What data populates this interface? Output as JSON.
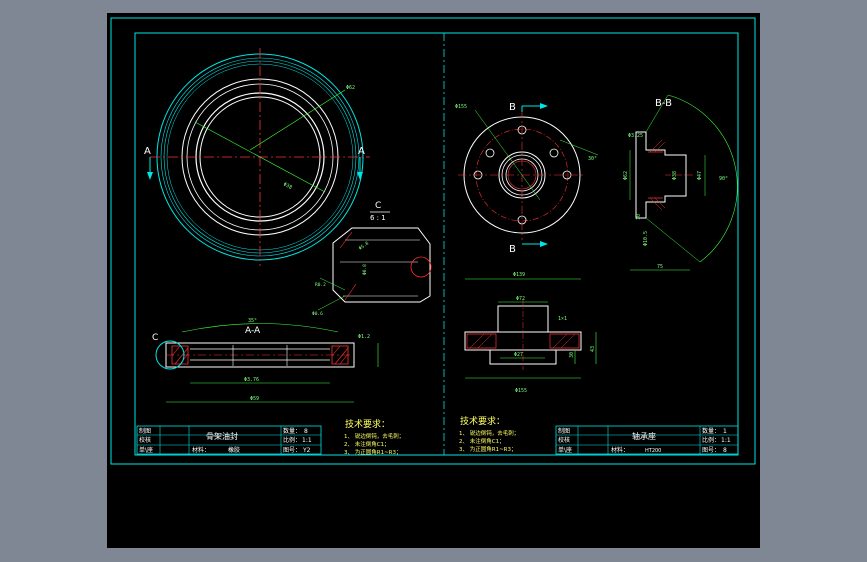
{
  "colors": {
    "background": "#7f8794",
    "canvas": "#000000",
    "frame": "#00e6e6",
    "outline": "#ffffff",
    "dimension": "#3cff3c",
    "centerline": "#ff3030",
    "hatch": "#ff3030",
    "note_text": "#ffff66"
  },
  "left_part": {
    "section_label": "A-A",
    "cut_label_a": "A",
    "detail_label": "C",
    "detail_scale": "6 : 1",
    "detail_ref": "C",
    "dims": {
      "outer": "Φ62",
      "inner": "Φ38",
      "angle": "35°",
      "bottom_inner": "Φ3.76",
      "bottom_outer": "Φ59",
      "right": "Φ1.2",
      "detail_a": "Φ5.8",
      "detail_b": "Φ0.8",
      "detail_c": "R0.2",
      "detail_d": "Φ0.6"
    },
    "notes_title": "技术要求：",
    "notes": [
      "1、 锐边倒钝，去毛刺；",
      "2、 未注倒角C1；",
      "3、 为正圆角R1~R3；"
    ],
    "title_block": {
      "design": "制图",
      "check": "校核",
      "name": "骨架油封",
      "qty_label": "数量：",
      "qty": "8",
      "scale_label": "比例：",
      "scale": "1:1",
      "unit": "单\\座",
      "material_label": "材料：",
      "material": "橡胶",
      "number_label": "图号：",
      "number": "Y2"
    }
  },
  "right_part": {
    "cut_label_b": "B",
    "section_label": "B-B",
    "dims": {
      "bolt_circle": "Φ155",
      "top_width": "Φ139",
      "boss": "Φ72",
      "bore": "Φ27",
      "bottom_width": "Φ155",
      "height_a": "43",
      "height_b": "30",
      "chamfer": "1×1",
      "sec_top": "Φ3.25",
      "sec_left": "Φ62",
      "sec_mid": "Φ38",
      "sec_right": "Φ47",
      "sec_small": "10",
      "sec_low": "Φ10.5",
      "sec_width": "75",
      "angle_right": "90°",
      "angle_top": "30°"
    },
    "notes_title": "技术要求：",
    "notes": [
      "1、 锐边倒钝，去毛刺；",
      "2、 未注倒角C1；",
      "3、 为正圆角R1~R3；"
    ],
    "title_block": {
      "design": "制图",
      "check": "校核",
      "name": "轴承座",
      "qty_label": "数量：",
      "qty": "1",
      "scale_label": "比例：",
      "scale": "1:1",
      "unit": "单\\座",
      "material_label": "材料：",
      "material": "HT200",
      "number_label": "图号：",
      "number": "8"
    }
  }
}
